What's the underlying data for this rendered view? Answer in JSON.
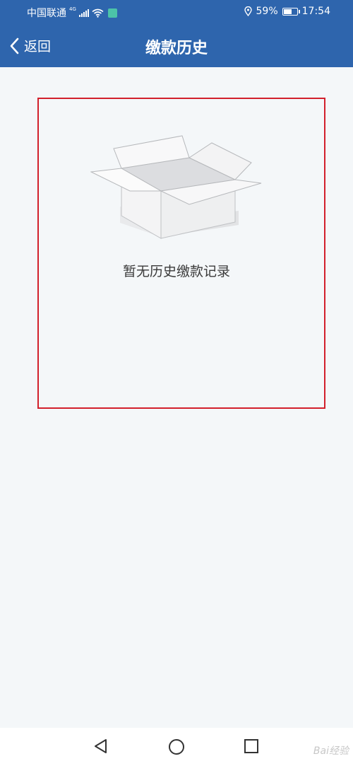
{
  "status_bar": {
    "carrier": "中国联通",
    "network": "4G",
    "location_icon": "location-pin-icon",
    "battery_percent": "59%",
    "battery_level": 0.59,
    "time": "17:54"
  },
  "header": {
    "back_label": "返回",
    "back_icon": "chevron-left-icon",
    "title": "缴款历史",
    "background_color": "#2e65ad"
  },
  "empty_state": {
    "icon": "empty-box-icon",
    "message": "暂无历史缴款记录"
  },
  "annotation": {
    "border_color": "#d2202c"
  },
  "nav_bar": {
    "back_icon": "triangle-back-icon",
    "home_icon": "circle-home-icon",
    "recents_icon": "square-recents-icon"
  },
  "watermark": "Bai经验"
}
